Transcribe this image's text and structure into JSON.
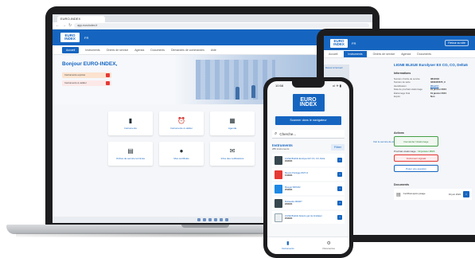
{
  "laptop": {
    "browser_tab": "EURO-INDEX",
    "url": "app.euroindex.fr",
    "header": {
      "logo": "EURO INDEX",
      "lang": "FR",
      "account_button": "Mon compte"
    },
    "nav": [
      "Accueil",
      "Instruments",
      "Ordres de service",
      "Agenda",
      "Documents",
      "Demandes de commandes",
      "Aide"
    ],
    "welcome": "Bonjour EURO-INDEX,",
    "alerts": [
      "Instruments expirés",
      "Instruments à valider"
    ],
    "cards": [
      "Instruments",
      "Instruments à valider",
      "Agenda",
      "Ordres de service terminés",
      "Mes certificats",
      "Infos des notifications"
    ]
  },
  "tablet": {
    "header": {
      "logo": "EURO INDEX",
      "lang": "FR",
      "back_button": "Retour au site"
    },
    "nav": [
      "Accueil",
      "Instruments",
      "Ordres de service",
      "Agenda",
      "Documents"
    ],
    "sidebar_title": "Retour à l'accueil",
    "title": "LIGNE BLEUE Eurolyser EX CO, CO, Delta5",
    "info_heading": "Informations",
    "info": [
      {
        "k": "Numéro d'ordre de service",
        "v": "0812018"
      },
      {
        "k": "Numéro de série",
        "v": "3302345675_C"
      },
      {
        "k": "Identification",
        "v": "[Ouvrir]"
      },
      {
        "k": "Date de prochain étalonnage",
        "v": "19 janvier 2024"
      },
      {
        "k": "Étalonnage final",
        "v": "19 janvier 2024"
      },
      {
        "k": "Expiré",
        "v": "Non"
      }
    ],
    "actions_heading": "Actions",
    "action_validate": "Demander l'étalonnage",
    "next_label": "Prochain étalonnage :",
    "next_date": "19 janvier 2024",
    "action_reported": "Instrument signalé",
    "action_question": "Poser une question",
    "documents_heading": "Documents",
    "document": {
      "name": "Certificat après jusage",
      "date": "19 juin 2024"
    },
    "side_link": "Voir le service de étalonnage"
  },
  "phone": {
    "status_time": "10:58",
    "status_right": "ııl ✈ ▮",
    "logo": "EURO INDEX",
    "scan_button": "Scanner dans le navigateur",
    "search_placeholder": "Cherche...",
    "list_title": "Instruments",
    "list_count": "285 instruments",
    "filter_button": "Filtrer",
    "items": [
      {
        "name": "LIGNE BLEUE Eurolyser EX CO, CO, Delta",
        "date": "29/2024"
      },
      {
        "name": "Mesure Pointage DMT Cl",
        "date": "15/2024"
      },
      {
        "name": "Bluegaz BR7203",
        "date": "25/2024"
      },
      {
        "name": "Multiaudio 2M/4RY",
        "date": "28/2024"
      },
      {
        "name": "LIGNE BLEUE Detecto gaz de fondateur",
        "date": "25/2024"
      }
    ],
    "tabs": [
      "Instruments",
      "Paramètres"
    ]
  }
}
